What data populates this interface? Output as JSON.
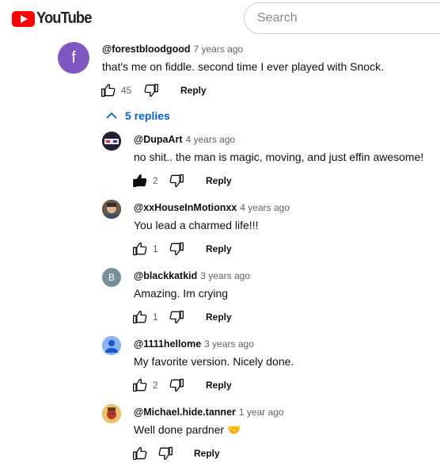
{
  "header": {
    "logo_text": "YouTube",
    "search_placeholder": "Search"
  },
  "colors": {
    "accent_link": "#065fd4",
    "logo_red": "#ff0000"
  },
  "comment": {
    "avatar_letter": "f",
    "author": "@forestbloodgood",
    "time": "7 years ago",
    "text": "that's me on fiddle. second time I ever played with Snock.",
    "likes": "45",
    "reply_label": "Reply"
  },
  "replies_toggle": {
    "label": "5 replies",
    "icon": "chevron-up-icon"
  },
  "replies": [
    {
      "author": "@DupaArt",
      "time": "4 years ago",
      "text": "no shit.. the man is magic, moving, and just effin awesome!",
      "likes": "2",
      "liked": true,
      "reply_label": "Reply"
    },
    {
      "author": "@xxHouseInMotionxx",
      "time": "4 years ago",
      "text": "You lead a charmed life!!!",
      "likes": "1",
      "liked": false,
      "reply_label": "Reply"
    },
    {
      "author": "@blackkatkid",
      "avatar_letter": "B",
      "time": "3 years ago",
      "text": "Amazing. Im crying",
      "likes": "1",
      "liked": false,
      "reply_label": "Reply"
    },
    {
      "author": "@1111hellome",
      "time": "3 years ago",
      "text": "My favorite version. Nicely done.",
      "likes": "2",
      "liked": false,
      "reply_label": "Reply"
    },
    {
      "author": "@Michael.hide.tanner",
      "time": "1 year ago",
      "text": "Well done pardner 🤝",
      "likes": "",
      "liked": false,
      "reply_label": "Reply"
    }
  ]
}
